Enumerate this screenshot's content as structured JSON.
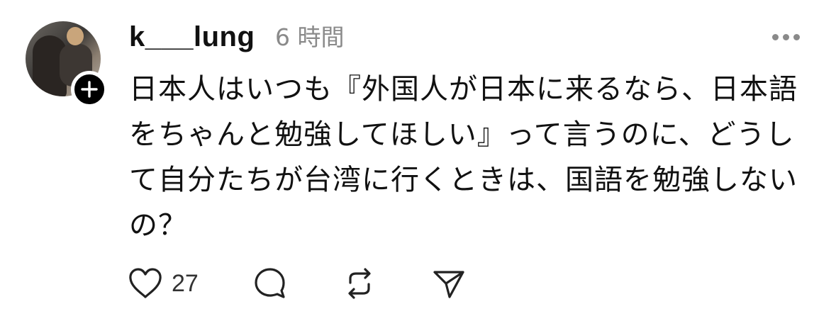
{
  "post": {
    "username": "k___lung",
    "timestamp": "6 時間",
    "text": "日本人はいつも『外国人が日本に来るなら、日本語をちゃんと勉強してほしい』って言うのに、どうして自分たちが台湾に行くときは、国語を勉強しないの？",
    "like_count": "27"
  },
  "icons": {
    "follow": "plus-icon",
    "more": "more-horizontal-icon",
    "like": "heart-icon",
    "comment": "comment-bubble-icon",
    "repost": "repost-icon",
    "share": "send-icon"
  },
  "colors": {
    "text": "#111111",
    "muted": "#8a8a8a",
    "badge": "#000000",
    "background": "#ffffff"
  }
}
